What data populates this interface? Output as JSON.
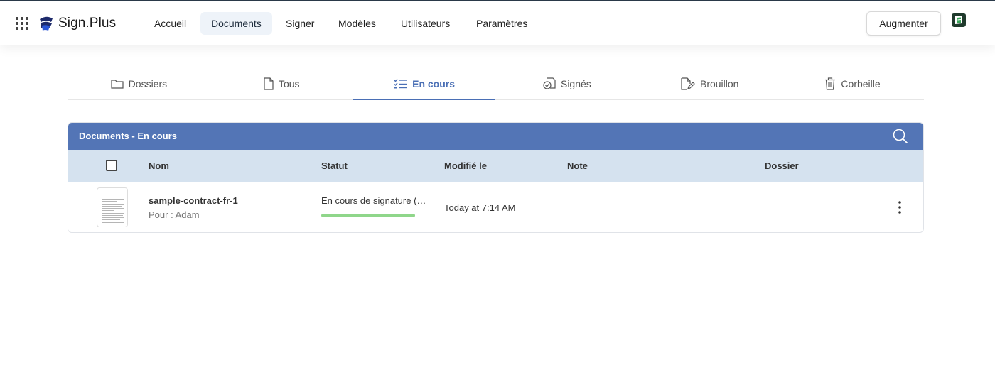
{
  "app": {
    "logo_text": "Sign.Plus"
  },
  "nav": {
    "items": [
      {
        "label": "Accueil",
        "active": false
      },
      {
        "label": "Documents",
        "active": true
      },
      {
        "label": "Signer",
        "active": false
      },
      {
        "label": "Modèles",
        "active": false
      },
      {
        "label": "Utilisateurs",
        "active": false
      },
      {
        "label": "Paramètres",
        "active": false
      }
    ],
    "upgrade_label": "Augmenter"
  },
  "tabs": [
    {
      "label": "Dossiers",
      "icon": "folder-icon"
    },
    {
      "label": "Tous",
      "icon": "file-icon"
    },
    {
      "label": "En cours",
      "icon": "checklist-icon",
      "active": true
    },
    {
      "label": "Signés",
      "icon": "signed-icon"
    },
    {
      "label": "Brouillon",
      "icon": "draft-icon"
    },
    {
      "label": "Corbeille",
      "icon": "trash-icon"
    }
  ],
  "panel": {
    "title": "Documents - En cours",
    "columns": {
      "name": "Nom",
      "status": "Statut",
      "modified": "Modifié le",
      "note": "Note",
      "folder": "Dossier"
    },
    "rows": [
      {
        "name": "sample-contract-fr-1",
        "recipient": "Pour : Adam",
        "status": "En cours de signature (…",
        "progress": 1.0,
        "modified": "Today at 7:14 AM",
        "note": "",
        "folder": ""
      }
    ]
  },
  "colors": {
    "accent": "#4a6fb5",
    "panel_header": "#5375b6",
    "table_header": "#d5e2ef",
    "progress": "#8fd68a",
    "nav_active_bg": "#eef3f9"
  }
}
